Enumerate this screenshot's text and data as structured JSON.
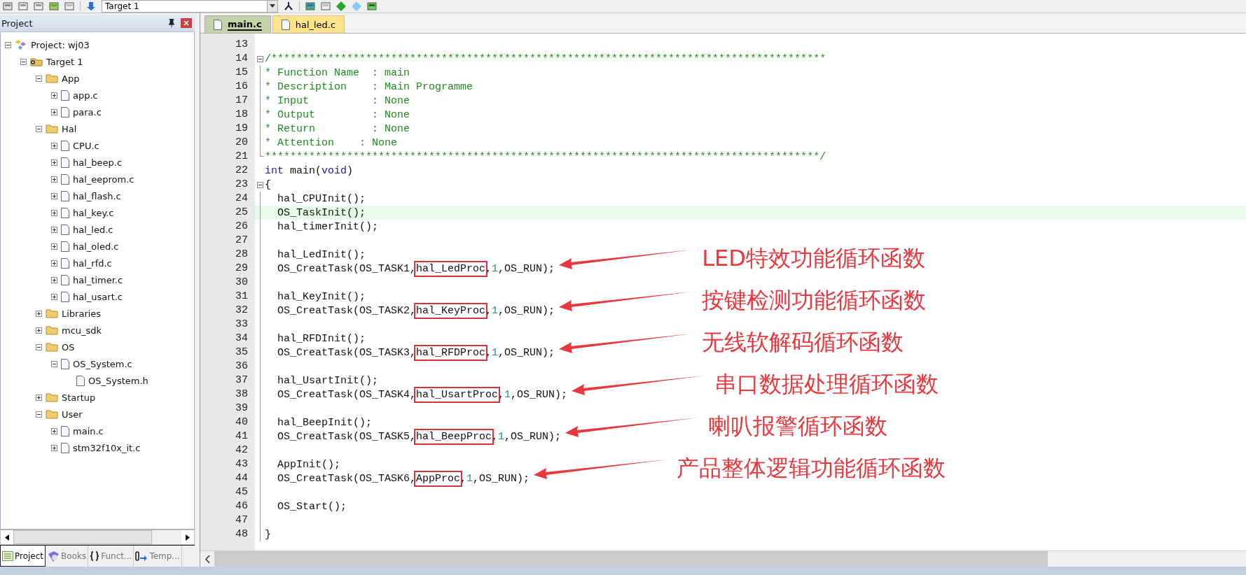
{
  "toolbar": {
    "target": "Target 1"
  },
  "project_panel": {
    "title": "Project",
    "tree": [
      {
        "label": "Project: wj03",
        "kind": "project",
        "expanded": true,
        "children": [
          {
            "label": "Target 1",
            "kind": "target",
            "expanded": true,
            "children": [
              {
                "label": "App",
                "kind": "folder",
                "expanded": true,
                "children": [
                  {
                    "label": "app.c",
                    "kind": "file",
                    "expanded": false
                  },
                  {
                    "label": "para.c",
                    "kind": "file",
                    "expanded": false
                  }
                ]
              },
              {
                "label": "Hal",
                "kind": "folder",
                "expanded": true,
                "children": [
                  {
                    "label": "CPU.c",
                    "kind": "file",
                    "expanded": false
                  },
                  {
                    "label": "hal_beep.c",
                    "kind": "file",
                    "expanded": false
                  },
                  {
                    "label": "hal_eeprom.c",
                    "kind": "file",
                    "expanded": false
                  },
                  {
                    "label": "hal_flash.c",
                    "kind": "file",
                    "expanded": false
                  },
                  {
                    "label": "hal_key.c",
                    "kind": "file",
                    "expanded": false
                  },
                  {
                    "label": "hal_led.c",
                    "kind": "file",
                    "expanded": false
                  },
                  {
                    "label": "hal_oled.c",
                    "kind": "file",
                    "expanded": false
                  },
                  {
                    "label": "hal_rfd.c",
                    "kind": "file",
                    "expanded": false
                  },
                  {
                    "label": "hal_timer.c",
                    "kind": "file",
                    "expanded": false
                  },
                  {
                    "label": "hal_usart.c",
                    "kind": "file",
                    "expanded": false
                  }
                ]
              },
              {
                "label": "Libraries",
                "kind": "folder",
                "expanded": false
              },
              {
                "label": "mcu_sdk",
                "kind": "folder",
                "expanded": false
              },
              {
                "label": "OS",
                "kind": "folder",
                "expanded": true,
                "children": [
                  {
                    "label": "OS_System.c",
                    "kind": "file",
                    "expanded": true,
                    "children": [
                      {
                        "label": "OS_System.h",
                        "kind": "file"
                      }
                    ]
                  }
                ]
              },
              {
                "label": "Startup",
                "kind": "folder",
                "expanded": false
              },
              {
                "label": "User",
                "kind": "folder",
                "expanded": true,
                "children": [
                  {
                    "label": "main.c",
                    "kind": "file",
                    "expanded": false
                  },
                  {
                    "label": "stm32f10x_it.c",
                    "kind": "file",
                    "expanded": false
                  }
                ]
              }
            ]
          }
        ]
      }
    ],
    "tabs": [
      {
        "label": "Project",
        "kind": "project",
        "selected": true
      },
      {
        "label": "Books",
        "kind": "books",
        "selected": false
      },
      {
        "label": "Funct...",
        "kind": "functions",
        "selected": false
      },
      {
        "label": "Temp...",
        "kind": "templates",
        "selected": false
      }
    ]
  },
  "editor": {
    "tabs": [
      {
        "label": "main.c",
        "selected": true
      },
      {
        "label": "hal_led.c",
        "selected": false
      }
    ],
    "lines": [
      {
        "number": "13",
        "current": false
      },
      {
        "number": "14",
        "current": false,
        "expanded": true,
        "tokens": [
          {
            "text": "/****************************************************************************************",
            "kind": "comment"
          }
        ]
      },
      {
        "number": "15",
        "current": false,
        "tokens": [
          {
            "text": "* Function Name  : main",
            "kind": "comment"
          }
        ]
      },
      {
        "number": "16",
        "current": false,
        "tokens": [
          {
            "text": "* Description    : Main Programme",
            "kind": "comment"
          }
        ]
      },
      {
        "number": "17",
        "current": false,
        "tokens": [
          {
            "text": "* Input          : None",
            "kind": "comment"
          }
        ]
      },
      {
        "number": "18",
        "current": false,
        "tokens": [
          {
            "text": "* Output         : None",
            "kind": "comment"
          }
        ]
      },
      {
        "number": "19",
        "current": false,
        "tokens": [
          {
            "text": "* Return         : None",
            "kind": "comment"
          }
        ]
      },
      {
        "number": "20",
        "current": false,
        "tokens": [
          {
            "text": "* Attention    : None",
            "kind": "comment"
          }
        ]
      },
      {
        "number": "21",
        "current": false,
        "fold_end": true,
        "tokens": [
          {
            "text": "****************************************************************************************/",
            "kind": "comment"
          }
        ]
      },
      {
        "number": "22",
        "current": false,
        "tokens": [
          {
            "text": "int",
            "kind": "keyword"
          },
          {
            "text": " main(",
            "kind": "code"
          },
          {
            "text": "void",
            "kind": "keyword"
          },
          {
            "text": ")",
            "kind": "code"
          }
        ]
      },
      {
        "number": "23",
        "current": false,
        "expanded": true,
        "tokens": [
          {
            "text": "{",
            "kind": "code"
          }
        ]
      },
      {
        "number": "24",
        "current": false,
        "tokens": [
          {
            "text": "  hal_CPUInit();",
            "kind": "code"
          }
        ]
      },
      {
        "number": "25",
        "current": true,
        "tokens": [
          {
            "text": "  OS_TaskInit();",
            "kind": "code"
          }
        ]
      },
      {
        "number": "26",
        "current": false,
        "tokens": [
          {
            "text": "  hal_timerInit();",
            "kind": "code"
          }
        ]
      },
      {
        "number": "27",
        "current": false
      },
      {
        "number": "28",
        "current": false,
        "tokens": [
          {
            "text": "  hal_LedInit();",
            "kind": "code"
          }
        ]
      },
      {
        "number": "29",
        "current": false,
        "annotation": "LED特效功能循环函数",
        "tokens": [
          {
            "text": "  OS_CreatTask(OS_TASK1,",
            "kind": "code"
          },
          {
            "text": "hal_LedProc",
            "kind": "boxed"
          },
          {
            "text": ",",
            "kind": "code"
          },
          {
            "text": "1",
            "kind": "number"
          },
          {
            "text": ",OS_RUN);",
            "kind": "code"
          }
        ]
      },
      {
        "number": "30",
        "current": false
      },
      {
        "number": "31",
        "current": false,
        "tokens": [
          {
            "text": "  hal_KeyInit();",
            "kind": "code"
          }
        ]
      },
      {
        "number": "32",
        "current": false,
        "annotation": "按键检测功能循环函数",
        "tokens": [
          {
            "text": "  OS_CreatTask(OS_TASK2,",
            "kind": "code"
          },
          {
            "text": "hal_KeyProc",
            "kind": "boxed"
          },
          {
            "text": ",",
            "kind": "code"
          },
          {
            "text": "1",
            "kind": "number"
          },
          {
            "text": ",OS_RUN);",
            "kind": "code"
          }
        ]
      },
      {
        "number": "33",
        "current": false
      },
      {
        "number": "34",
        "current": false,
        "tokens": [
          {
            "text": "  hal_RFDInit();",
            "kind": "code"
          }
        ]
      },
      {
        "number": "35",
        "current": false,
        "annotation": "无线软解码循环函数",
        "tokens": [
          {
            "text": "  OS_CreatTask(OS_TASK3,",
            "kind": "code"
          },
          {
            "text": "hal_RFDProc",
            "kind": "boxed"
          },
          {
            "text": ",",
            "kind": "code"
          },
          {
            "text": "1",
            "kind": "number"
          },
          {
            "text": ",OS_RUN);",
            "kind": "code"
          }
        ]
      },
      {
        "number": "36",
        "current": false
      },
      {
        "number": "37",
        "current": false,
        "tokens": [
          {
            "text": "  hal_UsartInit();",
            "kind": "code"
          }
        ]
      },
      {
        "number": "38",
        "current": false,
        "annotation": "串口数据处理循环函数",
        "tokens": [
          {
            "text": "  OS_CreatTask(OS_TASK4,",
            "kind": "code"
          },
          {
            "text": "hal_UsartProc",
            "kind": "boxed"
          },
          {
            "text": ",",
            "kind": "code"
          },
          {
            "text": "1",
            "kind": "number"
          },
          {
            "text": ",OS_RUN);",
            "kind": "code"
          }
        ]
      },
      {
        "number": "39",
        "current": false
      },
      {
        "number": "40",
        "current": false,
        "tokens": [
          {
            "text": "  hal_BeepInit();",
            "kind": "code"
          }
        ]
      },
      {
        "number": "41",
        "current": false,
        "annotation": "喇叭报警循环函数",
        "tokens": [
          {
            "text": "  OS_CreatTask(OS_TASK5,",
            "kind": "code"
          },
          {
            "text": "hal_BeepProc",
            "kind": "boxed"
          },
          {
            "text": ",",
            "kind": "code"
          },
          {
            "text": "1",
            "kind": "number"
          },
          {
            "text": ",OS_RUN);",
            "kind": "code"
          }
        ]
      },
      {
        "number": "42",
        "current": false
      },
      {
        "number": "43",
        "current": false,
        "tokens": [
          {
            "text": "  AppInit();",
            "kind": "code"
          }
        ]
      },
      {
        "number": "44",
        "current": false,
        "annotation": "产品整体逻辑功能循环函数",
        "tokens": [
          {
            "text": "  OS_CreatTask(OS_TASK6,",
            "kind": "code"
          },
          {
            "text": "AppProc",
            "kind": "boxed"
          },
          {
            "text": ",",
            "kind": "code"
          },
          {
            "text": "1",
            "kind": "number"
          },
          {
            "text": ",OS_RUN);",
            "kind": "code"
          }
        ]
      },
      {
        "number": "45",
        "current": false
      },
      {
        "number": "46",
        "current": false,
        "tokens": [
          {
            "text": "  OS_Start();",
            "kind": "code"
          }
        ]
      },
      {
        "number": "47",
        "current": false
      },
      {
        "number": "48",
        "current": false,
        "tokens": [
          {
            "text": "}",
            "kind": "code"
          }
        ]
      }
    ]
  }
}
